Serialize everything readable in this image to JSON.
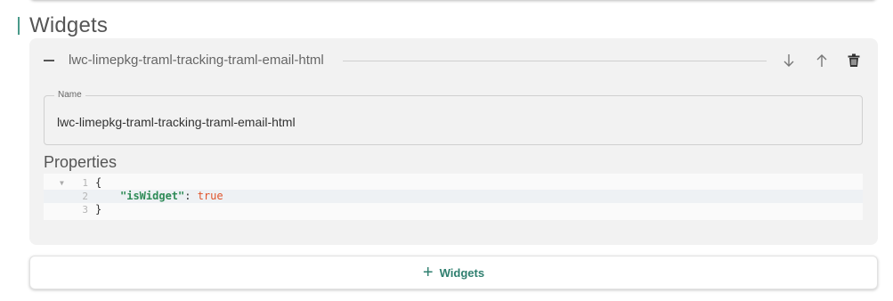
{
  "section": {
    "title": "Widgets"
  },
  "widget": {
    "header_label": "lwc-limepkg-traml-tracking-traml-email-html",
    "icons": {
      "collapse": "minus-icon",
      "move_down": "arrow-down-icon",
      "move_up": "arrow-up-icon",
      "delete": "trash-icon"
    },
    "name_field": {
      "label": "Name",
      "value": "lwc-limepkg-traml-tracking-traml-email-html"
    },
    "properties": {
      "label": "Properties",
      "code_lines": [
        {
          "number": "1",
          "open_brace": "{"
        },
        {
          "number": "2",
          "key": "\"isWidget\"",
          "colon": ": ",
          "value": "true"
        },
        {
          "number": "3",
          "close_brace": "}"
        }
      ]
    }
  },
  "add_button": {
    "label": "Widgets",
    "icon": "plus-icon"
  },
  "colors": {
    "accent": "#2f7f6f",
    "json_key": "#2e8b57",
    "json_bool": "#e0542b",
    "panel_bg": "#f2f2f2"
  }
}
